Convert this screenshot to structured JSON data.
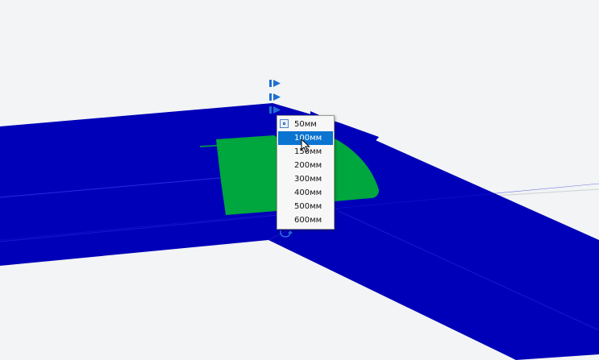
{
  "viewport": {
    "colors": {
      "background": "#f2f4f5",
      "beam": "#0000b8",
      "beam_dark": "#00009a",
      "plate": "#00a63e",
      "flag": "#1f6fd0"
    }
  },
  "dropdown": {
    "items": [
      "50мм",
      "100мм",
      "150мм",
      "200мм",
      "300мм",
      "400мм",
      "500мм",
      "600мм"
    ],
    "selected": "100мм",
    "checked": "50мм",
    "accent": "#0b74d1"
  },
  "icons": {
    "flags": "flag-icon",
    "cursor": "mouse-cursor-icon",
    "rotate": "rotate-handle-icon"
  }
}
